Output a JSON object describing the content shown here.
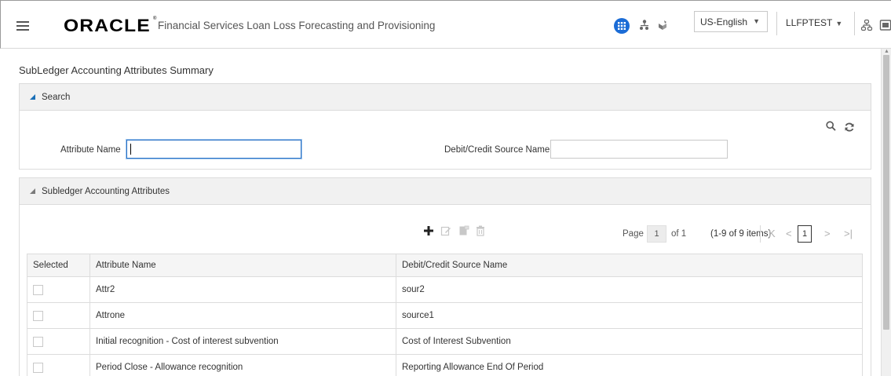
{
  "header": {
    "logo": "ORACLE",
    "registered": "®",
    "product_name": "Financial Services Loan Loss Forecasting and Provisioning",
    "language": "US-English",
    "user": "LLFPTEST"
  },
  "page": {
    "title": "SubLedger Accounting Attributes Summary"
  },
  "search_panel": {
    "title": "Search",
    "attribute_name_label": "Attribute Name",
    "attribute_name_value": "",
    "source_name_label": "Debit/Credit Source Name",
    "source_name_value": ""
  },
  "attributes_panel": {
    "title": "Subledger Accounting Attributes",
    "pager": {
      "page_label": "Page",
      "page_value": "1",
      "of_label": "of 1",
      "items_label": "(1-9 of 9 items)",
      "current_page": "1"
    },
    "columns": [
      "Selected",
      "Attribute Name",
      "Debit/Credit Source Name"
    ],
    "rows": [
      {
        "attribute": "Attr2",
        "source": "sour2"
      },
      {
        "attribute": "Attrone",
        "source": "source1"
      },
      {
        "attribute": "Initial recognition - Cost of interest subvention",
        "source": "Cost of Interest Subvention"
      },
      {
        "attribute": "Period Close - Allowance recognition",
        "source": "Reporting Allowance End Of Period"
      }
    ]
  },
  "colors": {
    "accent": "#1b6cd6",
    "panel_header": "#f1f1f1",
    "focus_border": "#2a72c5"
  },
  "icons": {
    "menu": "hamburger-icon",
    "apps": "apps-grid-icon",
    "hierarchy": "hierarchy-icon",
    "tools": "tools-icon",
    "org": "org-chart-icon",
    "window": "window-icon",
    "search": "search-icon",
    "reset": "reset-icon",
    "add": "plus-icon",
    "edit": "edit-icon",
    "copy": "copy-icon",
    "delete": "delete-icon"
  }
}
